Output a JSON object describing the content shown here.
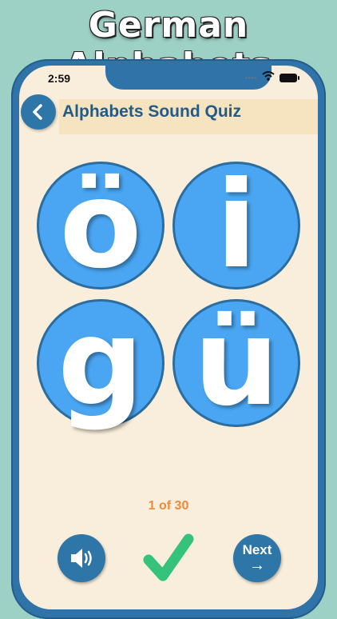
{
  "promo": {
    "title": "German Alphabets"
  },
  "status_bar": {
    "time": "2:59"
  },
  "header": {
    "title": "Alphabets Sound Quiz"
  },
  "quiz": {
    "letters": [
      "ö",
      "i",
      "g",
      "ü"
    ],
    "progress": "1 of 30"
  },
  "controls": {
    "next_label": "Next",
    "next_arrow": "→"
  },
  "colors": {
    "background": "#9ed1c5",
    "phone_frame": "#2f73a8",
    "screen": "#f9eedb",
    "letter_circle": "#4aa6f2",
    "accent_text": "#245b86",
    "progress_text": "#ee8a3a",
    "check_green": "#35c27a"
  },
  "icons": {
    "back": "chevron-left-icon",
    "speaker": "speaker-icon",
    "check": "checkmark-icon",
    "wifi": "wifi-icon",
    "battery": "battery-icon"
  }
}
